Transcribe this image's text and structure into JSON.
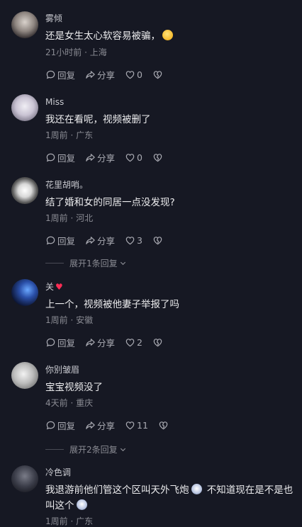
{
  "actions": {
    "reply_label": "回复",
    "share_label": "分享"
  },
  "comments": [
    {
      "username": "雾倾",
      "text": "还是女生太心软容易被骗，",
      "time": "21小时前",
      "location": "上海",
      "likes": "0"
    },
    {
      "username": "Miss",
      "text": "我还在看呢，视频被删了",
      "time": "1周前",
      "location": "广东",
      "likes": "0"
    },
    {
      "username": "花里胡哨。",
      "text": "结了婚和女的同居一点没发现?",
      "time": "1周前",
      "location": "河北",
      "likes": "3",
      "expand_label": "展开1条回复"
    },
    {
      "username": "关",
      "text": "上一个，视频被他妻子举报了吗",
      "time": "1周前",
      "location": "安徽",
      "likes": "2"
    },
    {
      "username": "你别皱眉",
      "text": "宝宝视频没了",
      "time": "4天前",
      "location": "重庆",
      "likes": "11",
      "expand_label": "展开2条回复"
    },
    {
      "username": "冷色调",
      "text_part1": "我退游前他们管这个区叫天外飞炮",
      "text_part2": "不知道现在是不是也叫这个",
      "time": "1周前",
      "location": "广东"
    }
  ]
}
